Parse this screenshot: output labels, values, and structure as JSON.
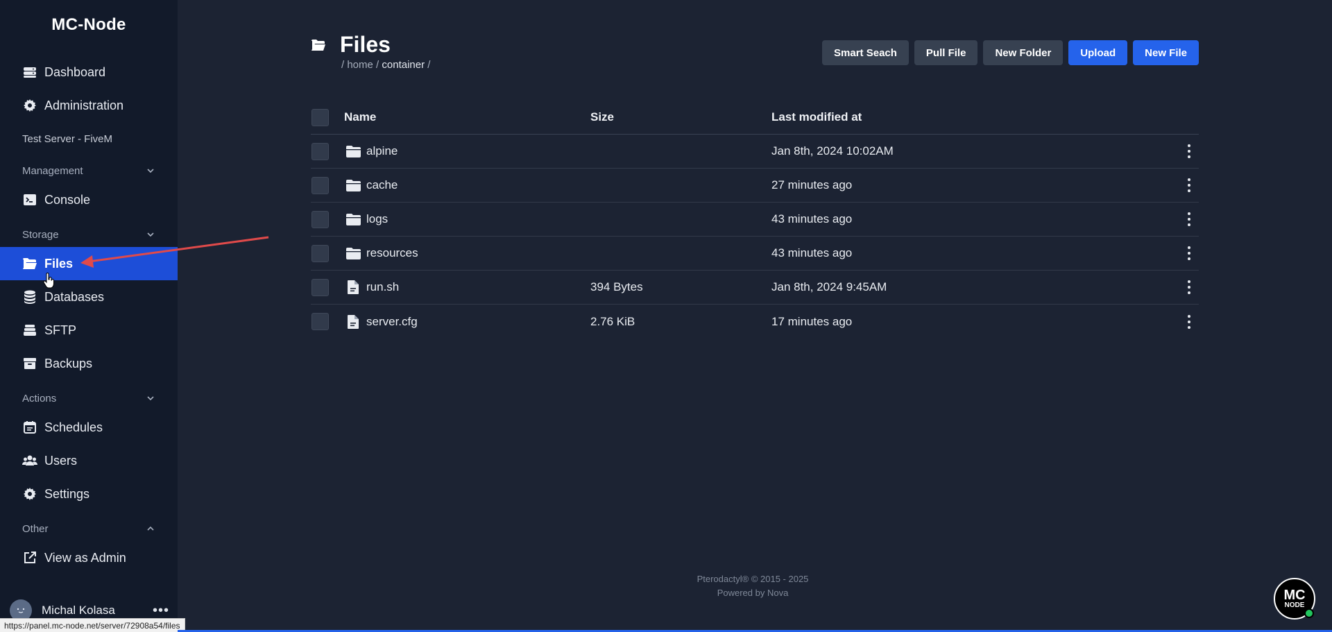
{
  "brand": "MC-Node",
  "nav_top": [
    {
      "label": "Dashboard",
      "icon": "server-icon"
    },
    {
      "label": "Administration",
      "icon": "gear-icon"
    }
  ],
  "server_name": "Test Server - FiveM",
  "sections": {
    "management": "Management",
    "storage": "Storage",
    "actions": "Actions",
    "other": "Other"
  },
  "nav": {
    "console": "Console",
    "files": "Files",
    "databases": "Databases",
    "sftp": "SFTP",
    "backups": "Backups",
    "schedules": "Schedules",
    "users": "Users",
    "settings": "Settings",
    "view_as_admin": "View as Admin"
  },
  "user": {
    "name": "Michal Kolasa",
    "more": "•••"
  },
  "page": {
    "title": "Files",
    "breadcrumb": {
      "sep1": "/ ",
      "home": "home",
      "sep2": " / ",
      "current": "container",
      "sep3": " /"
    }
  },
  "toolbar": {
    "smart_search": "Smart Seach",
    "pull_file": "Pull File",
    "new_folder": "New Folder",
    "upload": "Upload",
    "new_file": "New File"
  },
  "table": {
    "headers": {
      "name": "Name",
      "size": "Size",
      "modified": "Last modified at"
    },
    "rows": [
      {
        "name": "alpine",
        "type": "folder",
        "size": "",
        "modified": "Jan 8th, 2024 10:02AM"
      },
      {
        "name": "cache",
        "type": "folder",
        "size": "",
        "modified": "27 minutes ago"
      },
      {
        "name": "logs",
        "type": "folder",
        "size": "",
        "modified": "43 minutes ago"
      },
      {
        "name": "resources",
        "type": "folder",
        "size": "",
        "modified": "43 minutes ago"
      },
      {
        "name": "run.sh",
        "type": "file",
        "size": "394 Bytes",
        "modified": "Jan 8th, 2024 9:45AM"
      },
      {
        "name": "server.cfg",
        "type": "file",
        "size": "2.76 KiB",
        "modified": "17 minutes ago"
      }
    ]
  },
  "footer": {
    "line1": "Pterodactyl® © 2015 - 2025",
    "line2": "Powered by Nova"
  },
  "logo": {
    "line1": "MC",
    "line2": "NODE"
  },
  "status_url": "https://panel.mc-node.net/server/72908a54/files",
  "colors": {
    "sidebar": "#121a2a",
    "background": "#1c2333",
    "accent": "#2563eb",
    "active_nav": "#1d4ed8",
    "annotation_arrow": "#e04a4a"
  }
}
